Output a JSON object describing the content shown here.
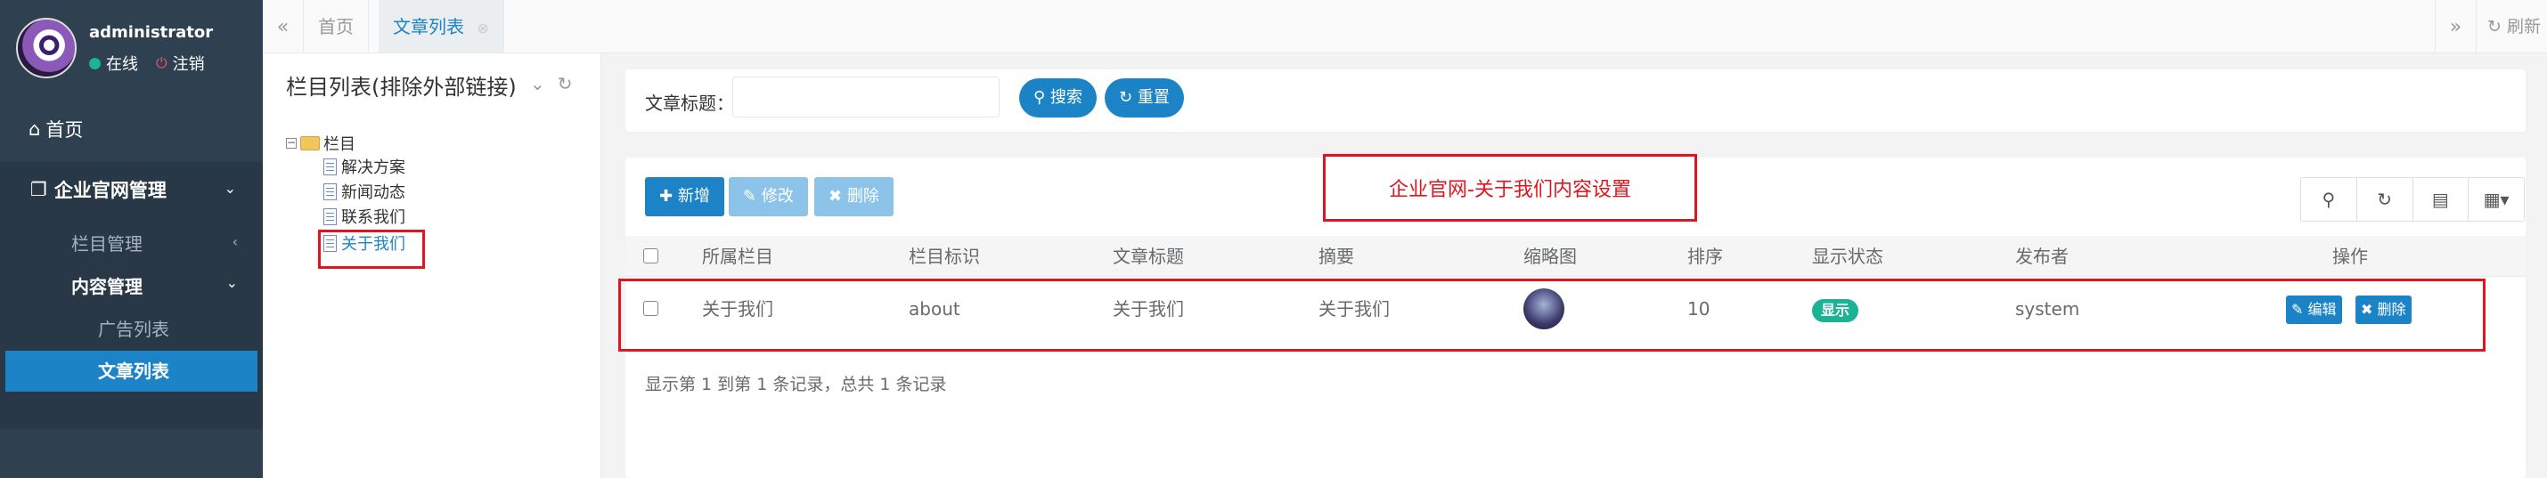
{
  "sidebar": {
    "username": "administrator",
    "status_online": "在线",
    "logout": "注销",
    "home": "首页",
    "group_title": "企业官网管理",
    "items": [
      {
        "label": "栏目管理"
      },
      {
        "label": "内容管理"
      },
      {
        "label": "广告列表"
      },
      {
        "label": "文章列表"
      }
    ]
  },
  "tabs": {
    "items": [
      {
        "label": "首页"
      },
      {
        "label": "文章列表"
      }
    ],
    "refresh": "刷新"
  },
  "category": {
    "title": "栏目列表(排除外部链接)",
    "root": "栏目",
    "nodes": [
      "解决方案",
      "新闻动态",
      "联系我们",
      "关于我们"
    ],
    "selected": "关于我们"
  },
  "search": {
    "label": "文章标题：",
    "value": "",
    "search_button": "搜索",
    "reset_button": "重置"
  },
  "toolbar": {
    "add": "新增",
    "edit": "修改",
    "delete": "删除"
  },
  "annotation": "企业官网-关于我们内容设置",
  "table": {
    "columns": [
      "所属栏目",
      "栏目标识",
      "文章标题",
      "摘要",
      "缩略图",
      "排序",
      "显示状态",
      "发布者",
      "操作"
    ],
    "rows": [
      {
        "category": "关于我们",
        "identifier": "about",
        "title": "关于我们",
        "summary": "关于我们",
        "sort": "10",
        "status": "显示",
        "publisher": "system",
        "edit": "编辑",
        "delete": "删除"
      }
    ],
    "page_info": "显示第 1 到第 1 条记录，总共 1 条记录"
  },
  "colors": {
    "sidebar_bg": "#2f4050",
    "primary": "#1c84c6",
    "success": "#1ab394",
    "annotation_red": "#e0151f"
  }
}
